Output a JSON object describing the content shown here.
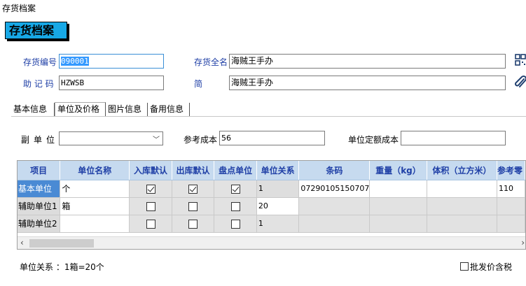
{
  "window": {
    "title": "存货档案"
  },
  "header": {
    "title": "存货档案"
  },
  "form": {
    "code_label": "存货编号",
    "code_value": "090001",
    "fullname_label": "存货全名",
    "fullname_value": "海贼王手办",
    "mnemonic_label": "助 记 码",
    "mnemonic_value": "HZWSB",
    "shortname_label": "简 名",
    "shortname_value": "海贼王手办"
  },
  "tabs": [
    {
      "label": "基本信息",
      "active": false
    },
    {
      "label": "单位及价格",
      "active": true
    },
    {
      "label": "图片信息",
      "active": false
    },
    {
      "label": "备用信息",
      "active": false
    }
  ],
  "unit_panel": {
    "sub_unit_label": "副单位",
    "sub_unit_value": "",
    "ref_cost_label": "参考成本",
    "ref_cost_value": "56",
    "quota_cost_label": "单位定额成本",
    "quota_cost_value": ""
  },
  "grid": {
    "columns": [
      "项目",
      "单位名称",
      "入库默认",
      "出库默认",
      "盘点单位",
      "单位关系",
      "条码",
      "重量（kg）",
      "体积（立方米）",
      "参考零"
    ],
    "rows": [
      {
        "item": "基本单位",
        "unit_name": "个",
        "in_default": true,
        "out_default": true,
        "stock_unit": true,
        "relation": "1",
        "barcode": "07290105150707",
        "weight": "",
        "volume": "",
        "ref": "110"
      },
      {
        "item": "辅助单位1",
        "unit_name": "箱",
        "in_default": false,
        "out_default": false,
        "stock_unit": false,
        "relation": "20",
        "barcode": "",
        "weight": "",
        "volume": "",
        "ref": ""
      },
      {
        "item": "辅助单位2",
        "unit_name": "",
        "in_default": false,
        "out_default": false,
        "stock_unit": false,
        "relation": "1",
        "barcode": "",
        "weight": "",
        "volume": "",
        "ref": ""
      }
    ]
  },
  "footer": {
    "relation_text": "单位关系 ：1箱=20个",
    "wholesale_tax_label": "批发价含税",
    "wholesale_tax_checked": false
  },
  "colors": {
    "accent": "#17a8e6",
    "label_blue": "#1f3fa6",
    "header_bg": "#c6daef",
    "selected_row": "#4a8ad4"
  },
  "icons": [
    "barcode-icon",
    "paperclip-icon",
    "dropdown-arrow-icon",
    "check-icon",
    "scroll-left-icon",
    "scroll-right-icon"
  ]
}
